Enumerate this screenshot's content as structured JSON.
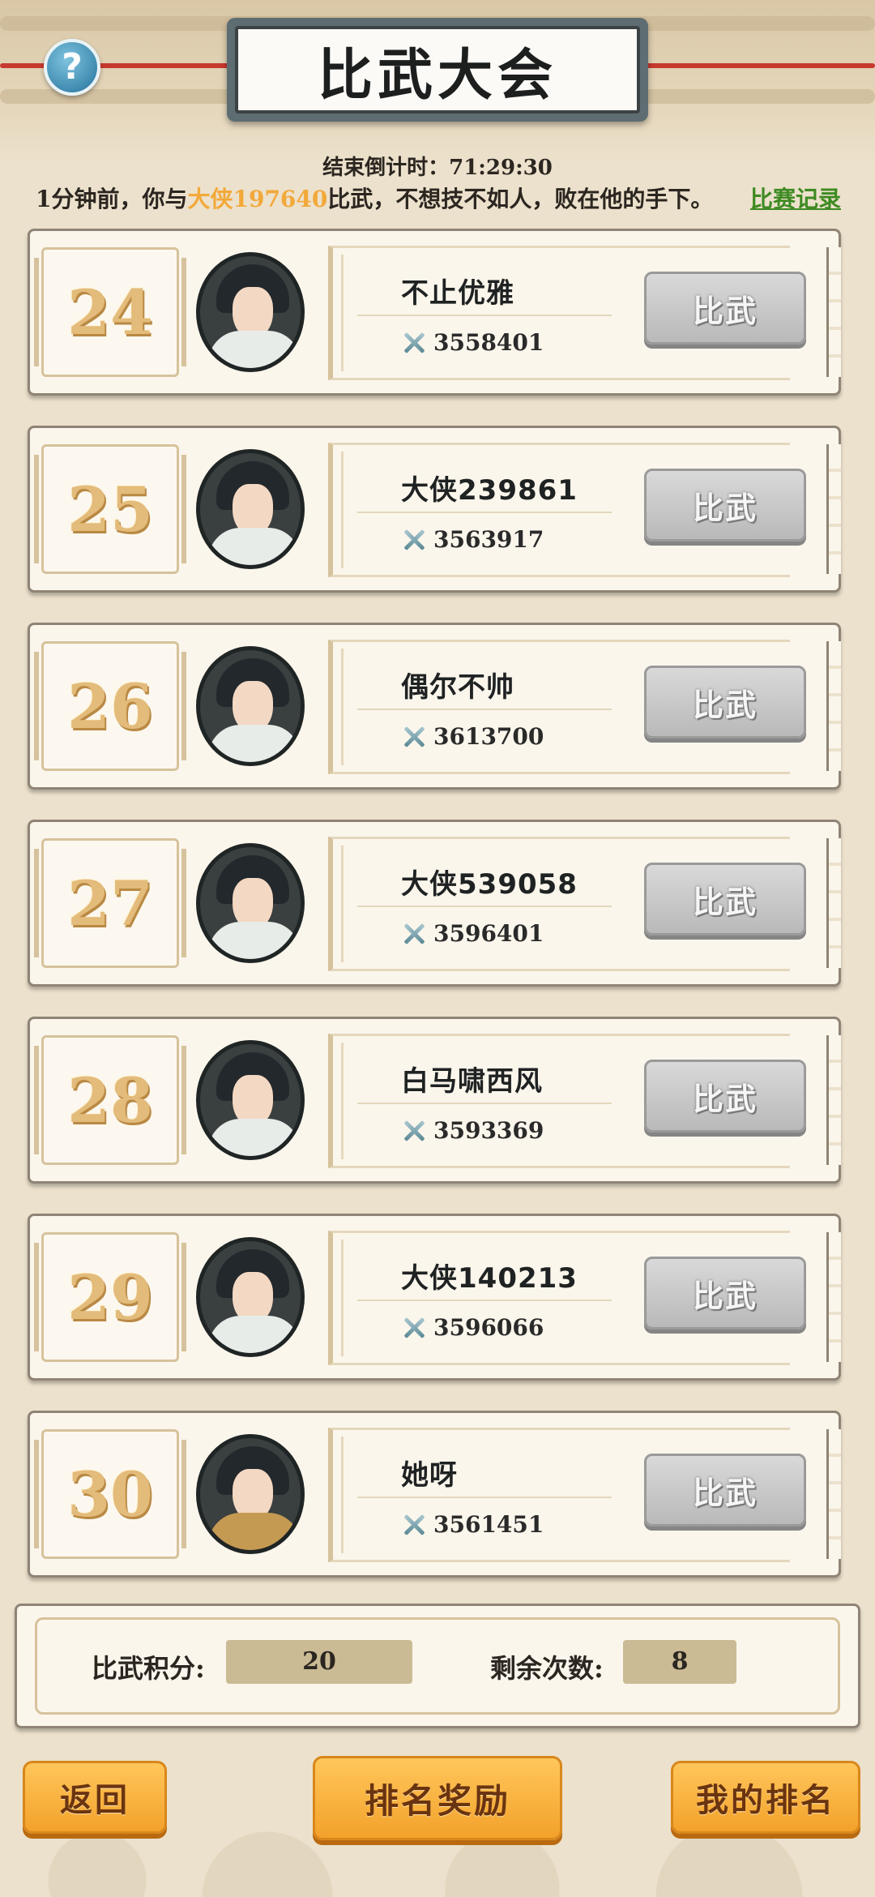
{
  "header": {
    "title": "比武大会",
    "help_symbol": "?"
  },
  "countdown": {
    "label": "结束倒计时：",
    "value": "71:29:30"
  },
  "news": {
    "prefix": "1分钟前，你与",
    "opponent": "大侠197640",
    "suffix": "比武，不想技不如人，败在他的手下。",
    "record_link": "比赛记录"
  },
  "players": [
    {
      "rank": "24",
      "name": "不止优雅",
      "power": "3558401",
      "action": "比武",
      "avatar": "swordsman-icon"
    },
    {
      "rank": "25",
      "name": "大侠239861",
      "power": "3563917",
      "action": "比武",
      "avatar": "swordsman-icon"
    },
    {
      "rank": "26",
      "name": "偶尔不帅",
      "power": "3613700",
      "action": "比武",
      "avatar": "swordsman-icon"
    },
    {
      "rank": "27",
      "name": "大侠539058",
      "power": "3596401",
      "action": "比武",
      "avatar": "swordsman-icon"
    },
    {
      "rank": "28",
      "name": "白马啸西风",
      "power": "3593369",
      "action": "比武",
      "avatar": "swordsman-icon"
    },
    {
      "rank": "29",
      "name": "大侠140213",
      "power": "3596066",
      "action": "比武",
      "avatar": "swordsman-icon"
    },
    {
      "rank": "30",
      "name": "她呀",
      "power": "3561451",
      "action": "比武",
      "avatar": "swordswoman-icon"
    }
  ],
  "stats": {
    "points_label": "比武积分:",
    "points_value": "20",
    "remaining_label": "剩余次数:",
    "remaining_value": "8"
  },
  "buttons": {
    "back": "返回",
    "rank_reward": "排名奖励",
    "my_rank": "我的排名"
  },
  "colors": {
    "highlight": "#f2a93a",
    "record_link": "#3e8a22",
    "action_button": "#c0c0c0",
    "bottom_button": "#f7b03d"
  }
}
